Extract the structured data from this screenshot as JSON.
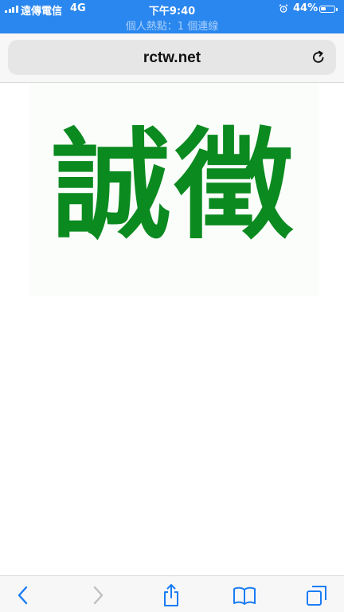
{
  "status_bar": {
    "carrier": "遠傳電信",
    "network": "4G",
    "time": "下午9:40",
    "battery_percent": "44%",
    "battery_level": 0.44,
    "alarm_icon": "alarm-clock-icon",
    "hotspot_text": "個人熱點：1 個連線",
    "background_color": "#2a87ef"
  },
  "browser": {
    "url": "rctw.net",
    "reload_icon": "reload-icon"
  },
  "page": {
    "logo_text": "誠徵",
    "logo_color": "#0b8a1f"
  },
  "toolbar": {
    "back_icon": "chevron-left-icon",
    "forward_icon": "chevron-right-icon",
    "share_icon": "share-icon",
    "bookmarks_icon": "open-book-icon",
    "tabs_icon": "tabs-icon",
    "accent_color": "#1a7cf5",
    "disabled_color": "#bfbfbf"
  }
}
